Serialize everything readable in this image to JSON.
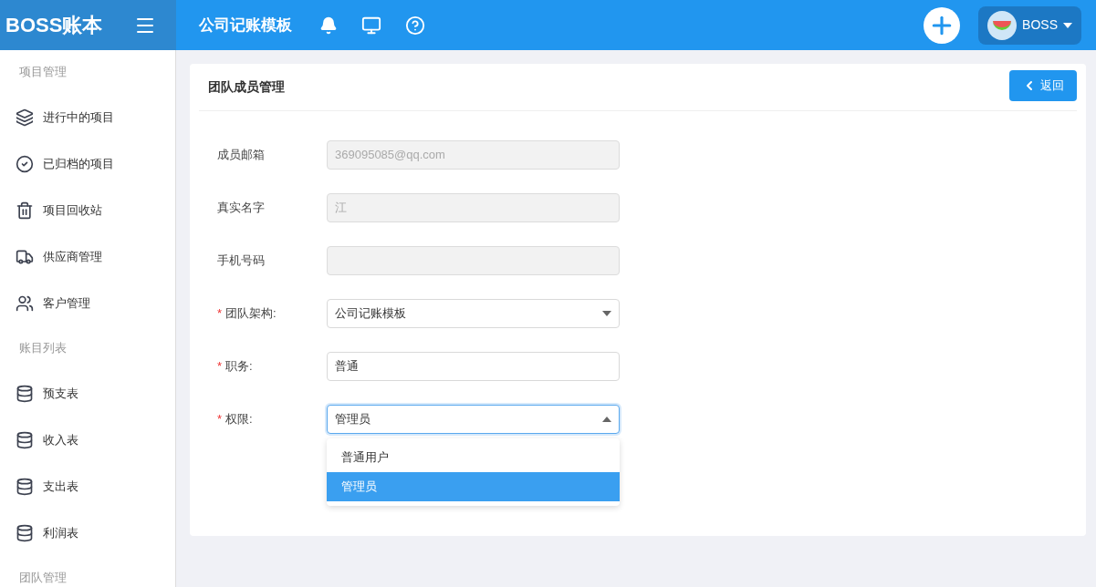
{
  "header": {
    "logo": "BOSS账本",
    "title": "公司记账模板",
    "user": "BOSS"
  },
  "sidebar": [
    {
      "kind": "section",
      "label": "项目管理"
    },
    {
      "kind": "item",
      "label": "进行中的项目"
    },
    {
      "kind": "item",
      "label": "已归档的项目"
    },
    {
      "kind": "item",
      "label": "项目回收站"
    },
    {
      "kind": "item",
      "label": "供应商管理"
    },
    {
      "kind": "item",
      "label": "客户管理"
    },
    {
      "kind": "section",
      "label": "账目列表"
    },
    {
      "kind": "item",
      "label": "预支表"
    },
    {
      "kind": "item",
      "label": "收入表"
    },
    {
      "kind": "item",
      "label": "支出表"
    },
    {
      "kind": "item",
      "label": "利润表"
    },
    {
      "kind": "section",
      "label": "团队管理"
    }
  ],
  "card": {
    "title": "团队成员管理",
    "back_button": "返回"
  },
  "fields": [
    {
      "kind": "input",
      "label": "成员邮箱",
      "disabled": true,
      "value": "369095085@qq.com"
    },
    {
      "kind": "input",
      "label": "真实名字",
      "disabled": true,
      "value": "江"
    },
    {
      "kind": "input",
      "label": "手机号码",
      "disabled": true
    },
    {
      "kind": "select",
      "required_mark": "*",
      "label": "团队架构:",
      "expanded": false,
      "value": "公司记账模板"
    },
    {
      "kind": "input",
      "required_mark": "*",
      "label": "职务:",
      "disabled": false,
      "value": "普通"
    },
    {
      "kind": "select",
      "required_mark": "*",
      "label": "权限:",
      "expanded": true,
      "value": "管理员",
      "options": [
        {
          "label": "普通用户",
          "selected": false
        },
        {
          "label": "管理员",
          "selected": true
        }
      ]
    }
  ]
}
